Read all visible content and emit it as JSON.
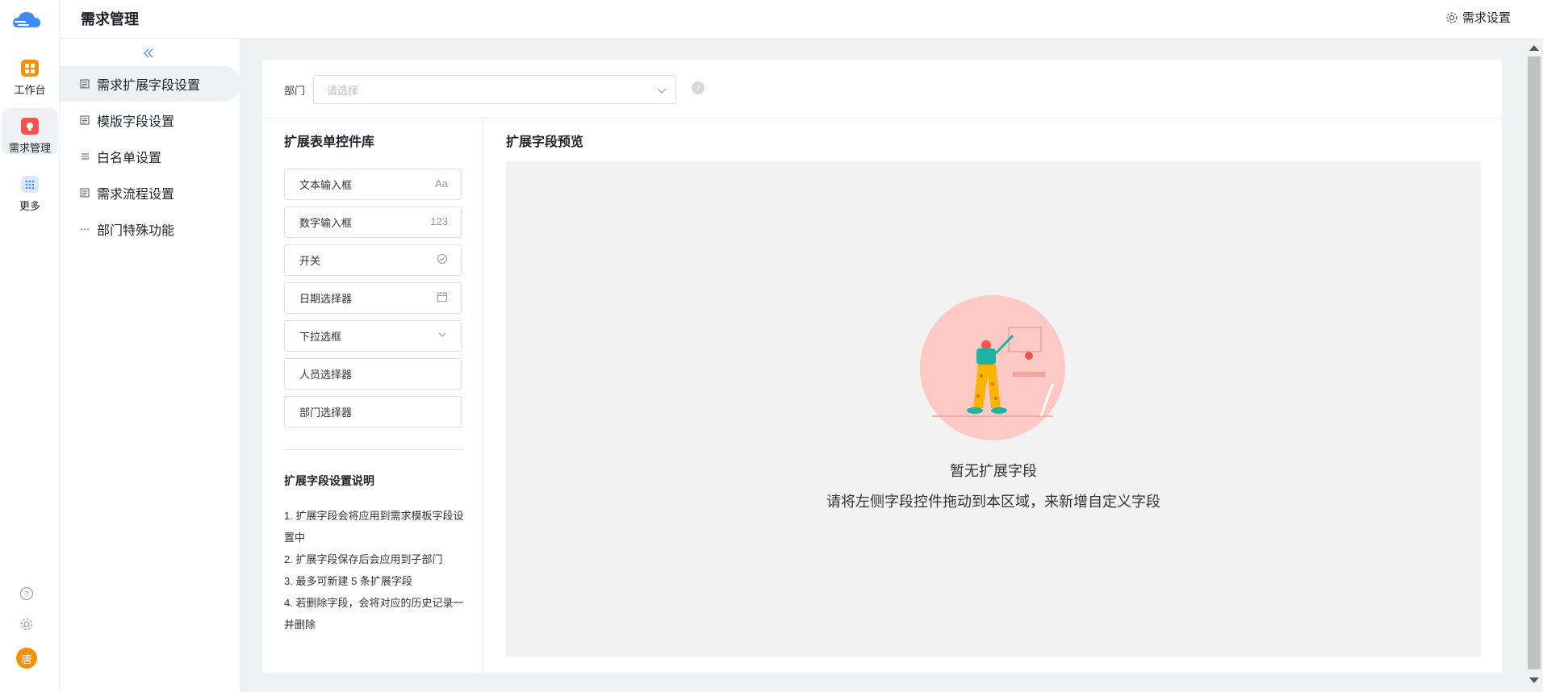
{
  "rail": {
    "items": [
      {
        "label": "工作台",
        "icon": "workbench-icon",
        "color": "#f5900a"
      },
      {
        "label": "需求管理",
        "icon": "lightbulb-icon",
        "color": "#f0544a"
      },
      {
        "label": "更多",
        "icon": "grid-dots-icon",
        "color": "#4e8ff0"
      }
    ],
    "bottom_icons": [
      "help-circle-icon",
      "gear-icon"
    ],
    "avatar_text": "唐"
  },
  "header": {
    "title": "需求管理",
    "settings_label": "需求设置"
  },
  "sidenav": {
    "items": [
      {
        "label": "需求扩展字段设置",
        "icon": "document-icon",
        "active": true
      },
      {
        "label": "模版字段设置",
        "icon": "document-icon",
        "active": false
      },
      {
        "label": "白名单设置",
        "icon": "list-icon",
        "active": false
      },
      {
        "label": "需求流程设置",
        "icon": "document-icon",
        "active": false
      },
      {
        "label": "部门特殊功能",
        "icon": "ellipsis-icon",
        "active": false
      }
    ]
  },
  "filter": {
    "label": "部门",
    "placeholder": "请选择"
  },
  "library": {
    "title": "扩展表单控件库",
    "controls": [
      {
        "label": "文本输入框",
        "icon_text": "Aa"
      },
      {
        "label": "数字输入框",
        "icon_text": "123"
      },
      {
        "label": "开关",
        "icon_text": ""
      },
      {
        "label": "日期选择器",
        "icon_text": ""
      },
      {
        "label": "下拉选框",
        "icon_text": ""
      },
      {
        "label": "人员选择器",
        "icon_text": ""
      },
      {
        "label": "部门选择器",
        "icon_text": ""
      }
    ],
    "notes_title": "扩展字段设置说明",
    "notes": [
      "1. 扩展字段会将应用到需求模板字段设置中",
      "2. 扩展字段保存后会应用到子部门",
      "3. 最多可新建 5 条扩展字段",
      "4. 若删除字段，会将对应的历史记录一并删除"
    ]
  },
  "preview": {
    "title": "扩展字段预览",
    "empty_title": "暂无扩展字段",
    "empty_hint": "请将左侧字段控件拖动到本区域，来新增自定义字段"
  },
  "colors": {
    "accent_blue": "#4e8ff0",
    "orange": "#f5900a",
    "red": "#f0544a"
  }
}
